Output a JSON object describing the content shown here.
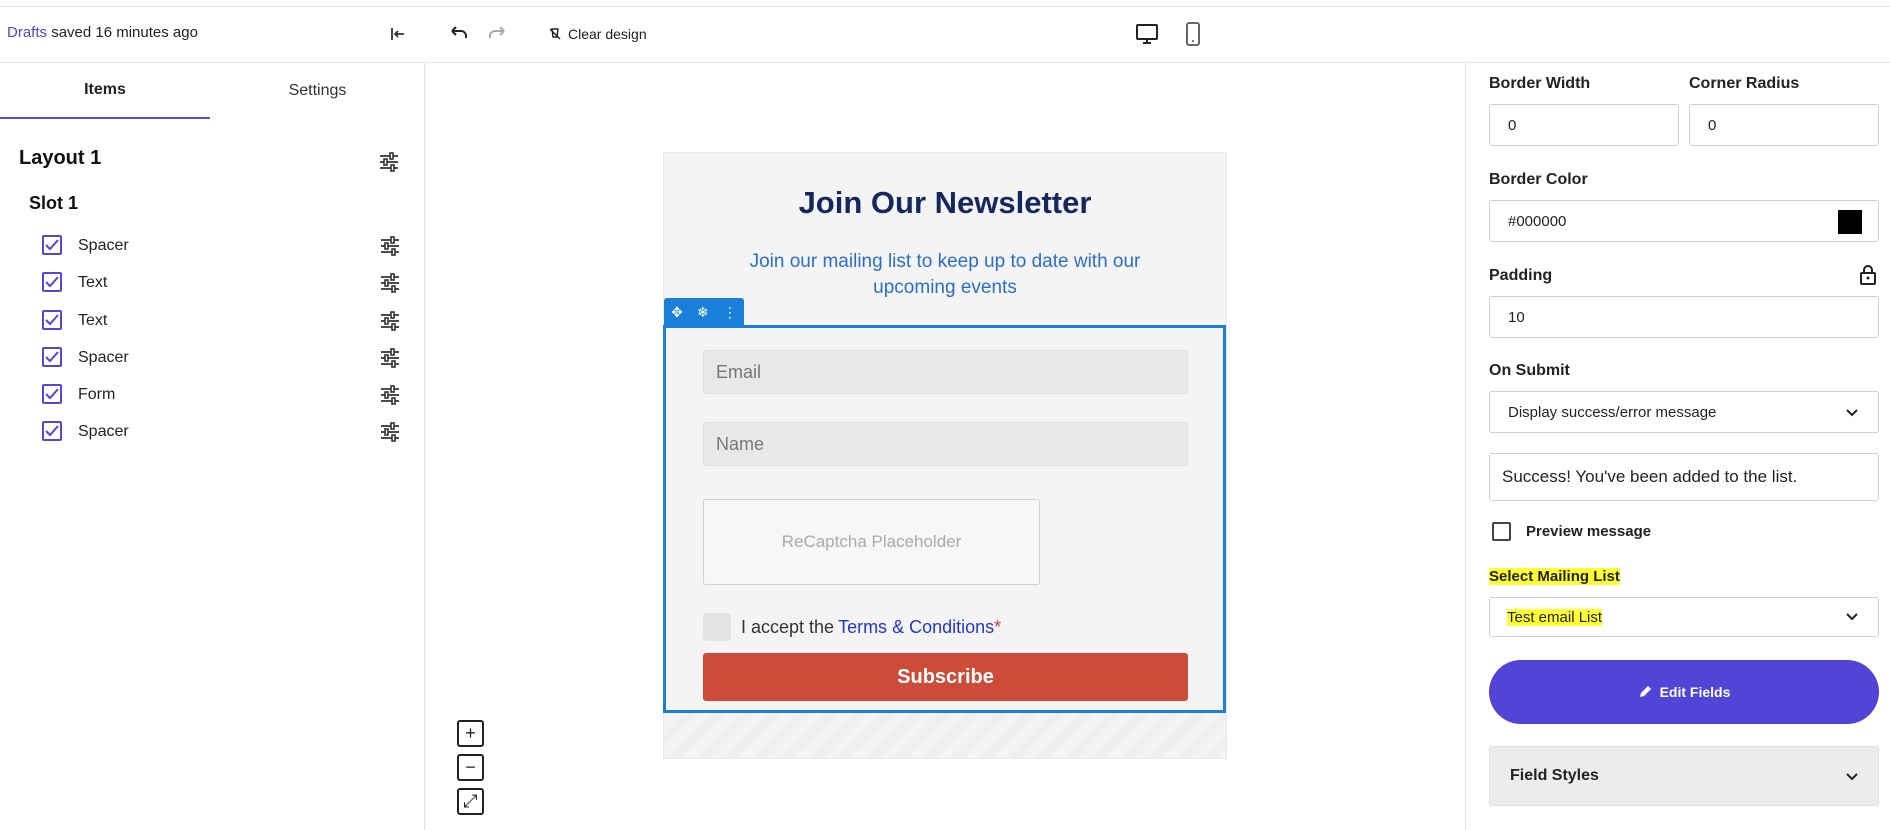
{
  "topbar": {
    "drafts_link": "Drafts",
    "saved_text": "saved 16 minutes ago",
    "clear_design": "Clear design"
  },
  "sidebar": {
    "tabs": [
      {
        "label": "Items"
      },
      {
        "label": "Settings"
      }
    ],
    "layout_title": "Layout 1",
    "slot_title": "Slot 1",
    "items": [
      {
        "label": "Spacer"
      },
      {
        "label": "Text"
      },
      {
        "label": "Text"
      },
      {
        "label": "Spacer"
      },
      {
        "label": "Form"
      },
      {
        "label": "Spacer"
      }
    ]
  },
  "canvas": {
    "title": "Join Our Newsletter",
    "subtitle": "Join our mailing list to keep up to date with our upcoming events",
    "email_placeholder": "Email",
    "name_placeholder": "Name",
    "captcha": "ReCaptcha Placeholder",
    "terms_prefix": "I accept the",
    "terms_link": "Terms & Conditions",
    "terms_required": "*",
    "subscribe": "Subscribe",
    "zoom_in": "+",
    "zoom_out": "−",
    "fit": "⤢"
  },
  "props": {
    "border_width_label": "Border Width",
    "border_width": "0",
    "corner_radius_label": "Corner Radius",
    "corner_radius": "0",
    "border_color_label": "Border Color",
    "border_color": "#000000",
    "padding_label": "Padding",
    "padding": "10",
    "on_submit_label": "On Submit",
    "on_submit_value": "Display success/error message",
    "success_message": "Success! You've been added to the list.",
    "preview_label": "Preview message",
    "mailing_label": "Select Mailing List",
    "mailing_value": "Test email List",
    "edit_fields": "Edit Fields",
    "field_styles": "Field Styles"
  },
  "colors": {
    "accent": "#5144d6",
    "selection": "#1a7fd8",
    "subscribe": "#cd4b39",
    "title": "#14285e"
  }
}
